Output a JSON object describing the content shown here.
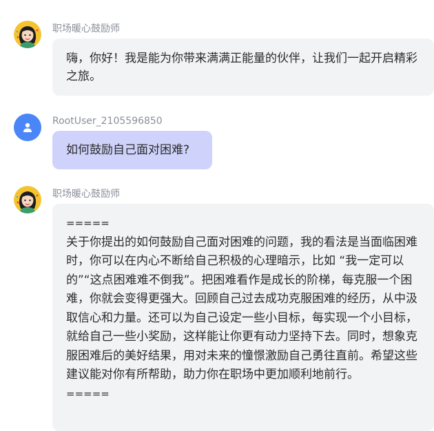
{
  "messages": [
    {
      "role": "assistant",
      "sender": "职场暖心鼓励师",
      "text": "嗨，你好！我是能为你带来满满正能量的伙伴，让我们一起开启精彩之旅。"
    },
    {
      "role": "user",
      "sender": "RootUser_2105596850",
      "text": "如何鼓励自己面对困难?"
    },
    {
      "role": "assistant",
      "sender": "职场暖心鼓励师",
      "divider_top": "=====",
      "text": "关于你提出的如何鼓励自己面对困难的问题，我的看法是当面临困难时，你可以在内心不断给自己积极的心理暗示，比如 “我一定可以的”“这点困难难不倒我”。把困难看作是成长的阶梯，每克服一个困难，你就会变得更强大。回顾自己过去成功克服困难的经历，从中汲取信心和力量。还可以为自己设定一些小目标，每实现一个小目标，就给自己一些小奖励，这样能让你更有动力坚持下去。同时，想象克服困难后的美好结果，用对未来的憧憬激励自己勇往直前。希望这些建议能对你有所帮助，助力你在职场中更加顺利地前行。",
      "divider_bottom": "====="
    }
  ],
  "icons": {
    "assistant_avatar": "cartoon-woman-avatar-icon",
    "user_avatar": "person-icon"
  },
  "colors": {
    "assistant_bubble": "#f2f3f5",
    "user_bubble": "#cfd3fb",
    "user_avatar_bg": "#4a86f7",
    "sender_text": "#8a8f99"
  }
}
